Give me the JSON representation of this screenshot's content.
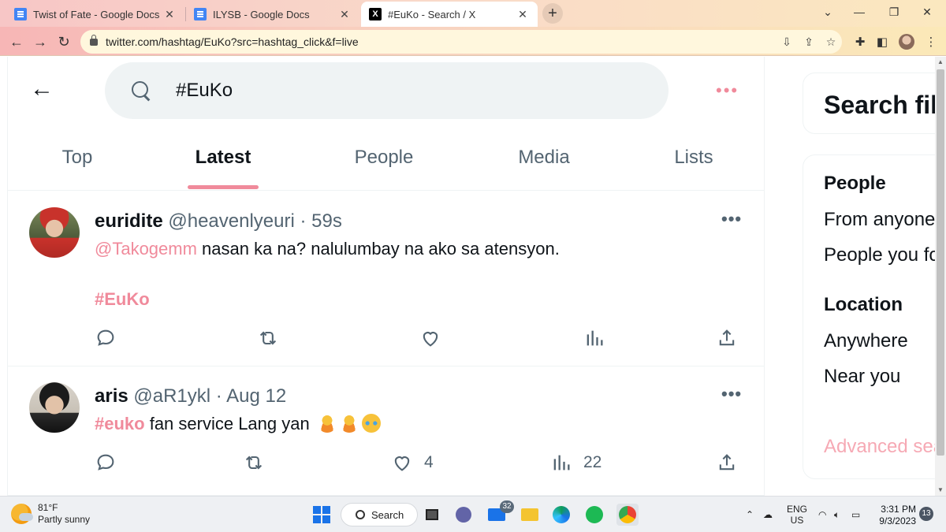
{
  "browser": {
    "tabs": [
      {
        "title": "Twist of Fate - Google Docs",
        "icon": "google-docs-icon",
        "active": false
      },
      {
        "title": "ILYSB - Google Docs",
        "icon": "google-docs-icon",
        "active": false
      },
      {
        "title": "#EuKo - Search / X",
        "icon": "x-logo-icon",
        "active": true
      }
    ],
    "url": "twitter.com/hashtag/EuKo?src=hashtag_click&f=live",
    "x_glyph": "X",
    "newtab_glyph": "+"
  },
  "search": {
    "query": "#EuKo",
    "tabs": [
      "Top",
      "Latest",
      "People",
      "Media",
      "Lists"
    ],
    "active_tab": "Latest",
    "accent_color": "#f08a9b"
  },
  "tweets": [
    {
      "name": "euridite",
      "handle": "@heavenlyeuri",
      "sep": " · ",
      "time": "59s",
      "mention": "@Takogemm",
      "text": " nasan ka na? nalulumbay na ako sa atensyon.",
      "hashtag": "#EuKo",
      "likes": "",
      "views": ""
    },
    {
      "name": "aris",
      "handle": "@aR1ykl",
      "sep": " · ",
      "time": "Aug 12",
      "hashtag": "#euko",
      "text": " fan service Lang yan",
      "likes": "4",
      "views": "22"
    }
  ],
  "sidebar": {
    "card_title": "Search filters",
    "people_heading": "People",
    "people_options": [
      "From anyone",
      "People you follow"
    ],
    "location_heading": "Location",
    "location_options": [
      "Anywhere",
      "Near you"
    ],
    "advanced": "Advanced search"
  },
  "taskbar": {
    "temp": "81°F",
    "weather": "Partly sunny",
    "search_label": "Search",
    "mail_badge": "32",
    "lang_top": "ENG",
    "lang_bottom": "US",
    "time": "3:31 PM",
    "date": "9/3/2023",
    "notifications": "13"
  }
}
